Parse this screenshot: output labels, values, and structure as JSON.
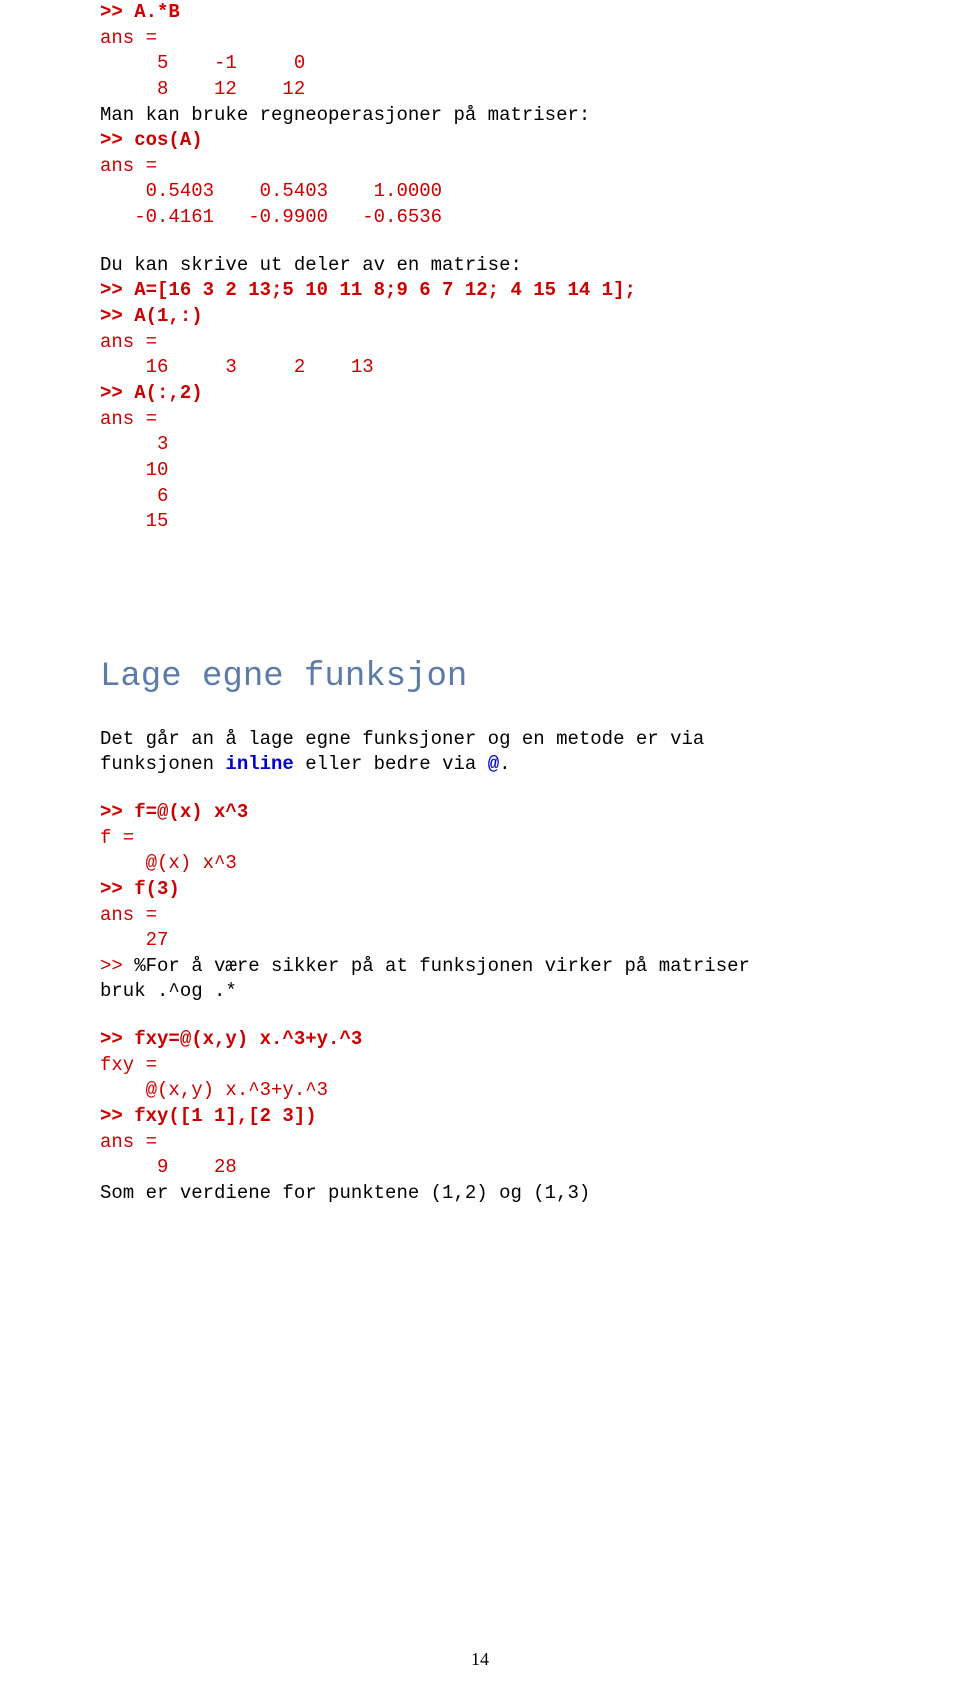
{
  "block1": {
    "l1": ">> A.*B",
    "l2": "ans =",
    "l3": "     5    -1     0",
    "l4": "     8    12    12"
  },
  "text1": "Man kan bruke regneoperasjoner på matriser:",
  "block2": {
    "l1": ">> cos(A)",
    "l2": "ans =",
    "l3": "    0.5403    0.5403    1.0000",
    "l4": "   -0.4161   -0.9900   -0.6536"
  },
  "text2": "Du kan skrive ut deler av en matrise:",
  "block3": {
    "l1": ">> A=[16 3 2 13;5 10 11 8;9 6 7 12; 4 15 14 1];",
    "l2": ">> A(1,:)",
    "l3": "ans =",
    "l4": "    16     3     2    13",
    "l5": ">> A(:,2)",
    "l6": "ans =",
    "l7": "     3",
    "l8": "    10",
    "l9": "     6",
    "l10": "    15"
  },
  "heading": "Lage egne funksjon",
  "para1a": "Det går an å lage egne funksjoner og en metode er via",
  "para1b_pre": "funksjonen ",
  "para1b_kw1": "inline",
  "para1b_mid": " eller bedre via ",
  "para1b_kw2": "@",
  "para1b_post": ".",
  "block4": {
    "l1": ">> f=@(x) x^3",
    "l2": "f =",
    "l3": "    @(x) x^3",
    "l4": ">> f(3)",
    "l5": "ans =",
    "l6": "    27",
    "l7a": ">> ",
    "l7b": "%For å være sikker på at funksjonen virker på matriser",
    "l8": "bruk .^og .*"
  },
  "block5": {
    "l1": ">> fxy=@(x,y) x.^3+y.^3",
    "l2": "fxy =",
    "l3": "    @(x,y) x.^3+y.^3",
    "l4": ">> fxy([1 1],[2 3])",
    "l5": "ans =",
    "l6": "     9    28"
  },
  "text3": "Som er verdiene for punktene (1,2) og (1,3)",
  "pagenum": "14"
}
